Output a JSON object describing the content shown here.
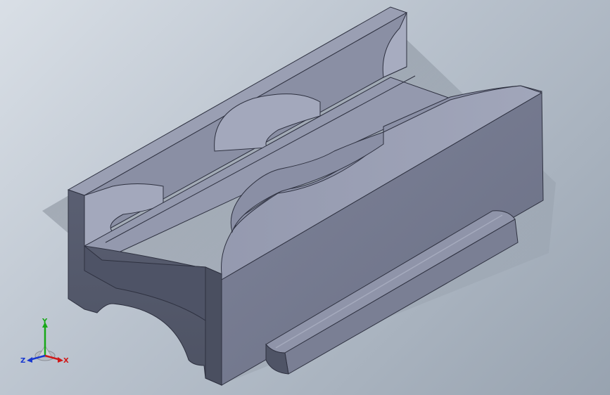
{
  "viewport": {
    "colors": {
      "background_light": "#d9dfe6",
      "background_dark": "#98a3b0",
      "part_face_light": "#8f95ab",
      "part_face_mid": "#7a7f95",
      "part_face_dark": "#5f6478",
      "edge": "#2e3140"
    }
  },
  "triad": {
    "x_label": "X",
    "y_label": "Y",
    "z_label": "Z",
    "x_color": "#d01818",
    "y_color": "#18a818",
    "z_color": "#1838d0"
  }
}
